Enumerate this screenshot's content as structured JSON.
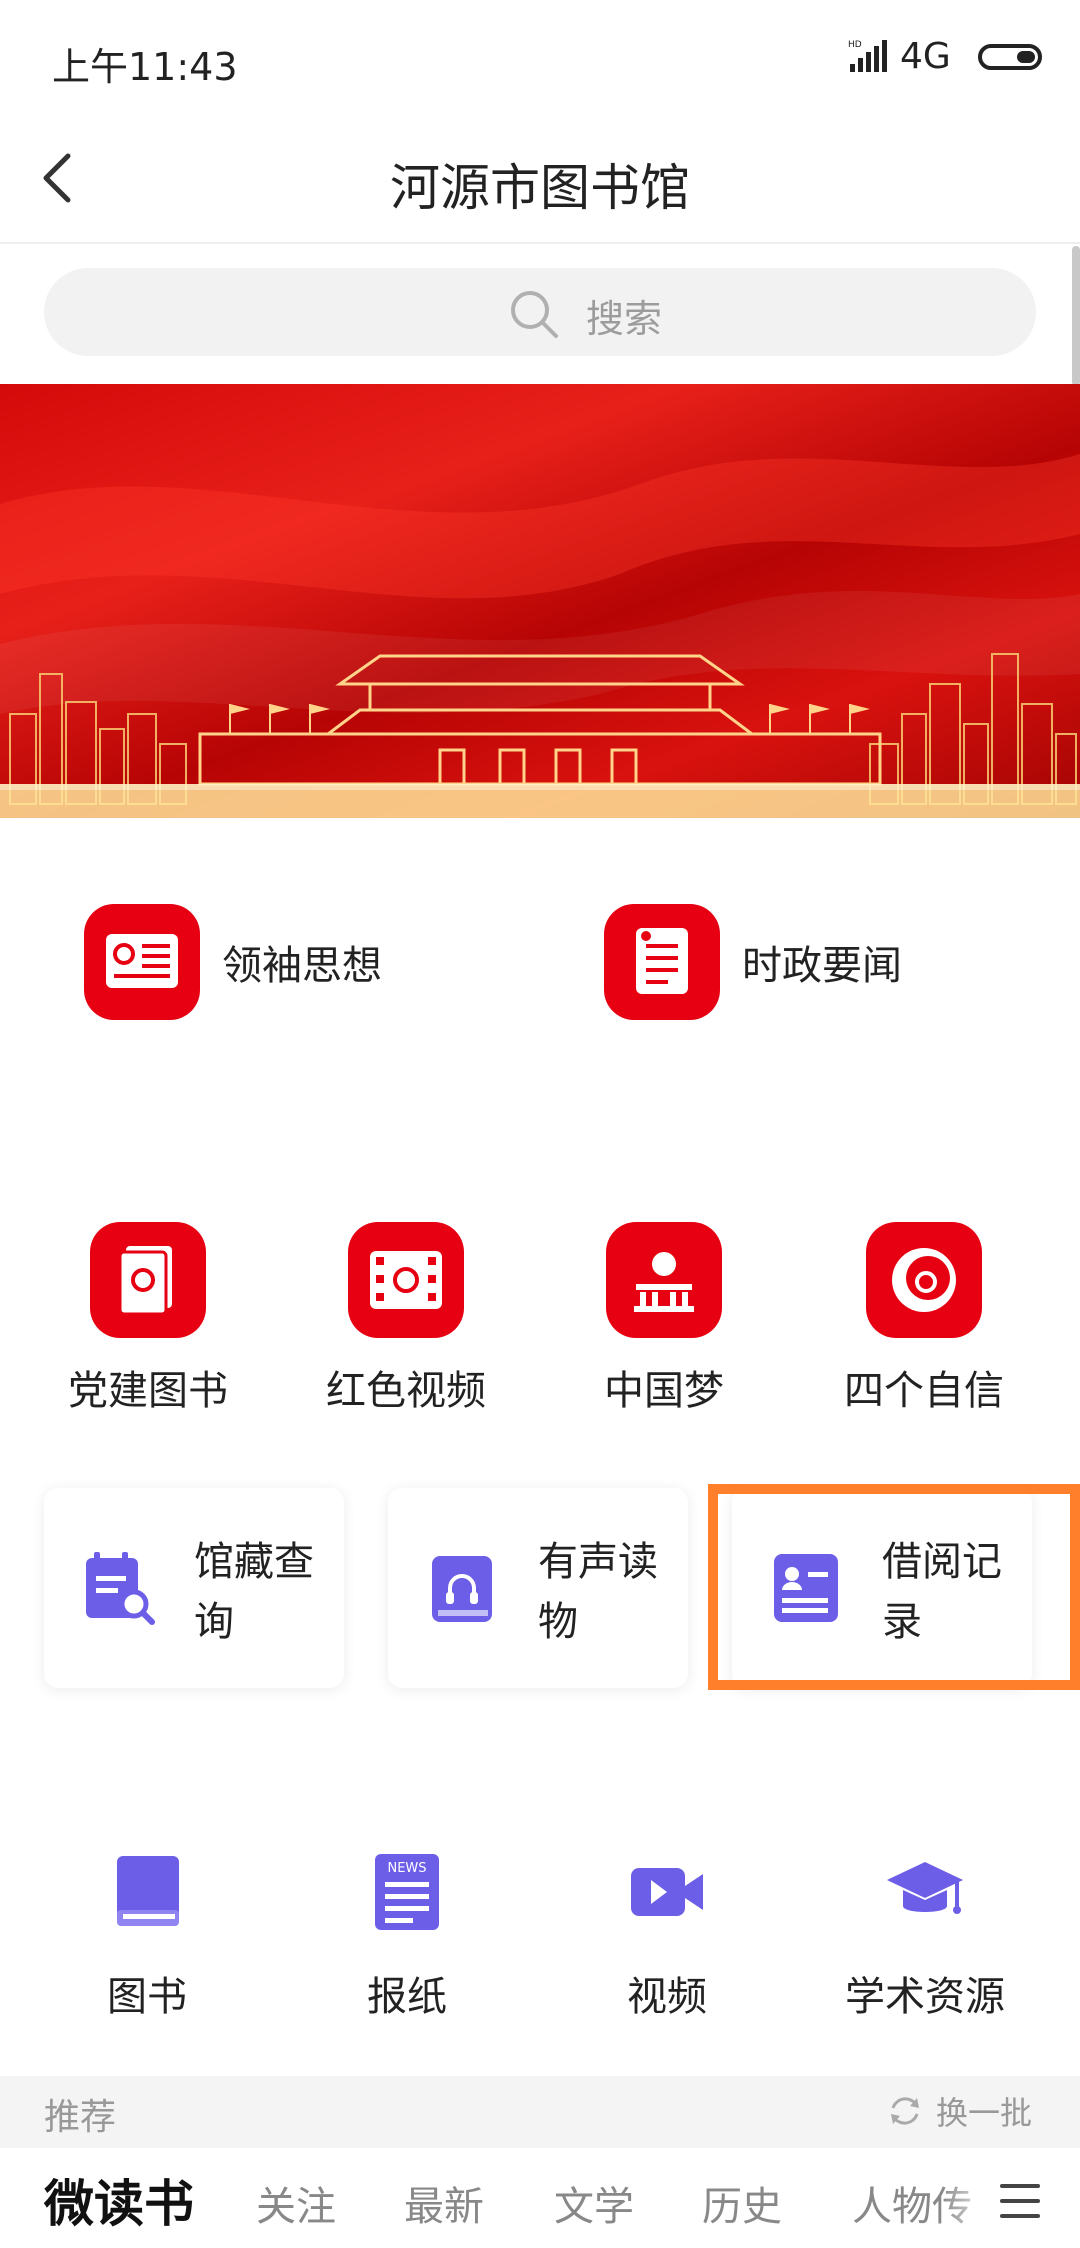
{
  "status_bar": {
    "time": "上午11:43",
    "network": "4G"
  },
  "header": {
    "title": "河源市图书馆"
  },
  "search": {
    "placeholder": "搜索"
  },
  "party_row1": [
    {
      "label": "领袖思想"
    },
    {
      "label": "时政要闻"
    }
  ],
  "party_row2": [
    {
      "label": "党建图书"
    },
    {
      "label": "红色视频"
    },
    {
      "label": "中国梦"
    },
    {
      "label": "四个自信"
    }
  ],
  "cards": [
    {
      "label": "馆藏查询"
    },
    {
      "label": "有声读物"
    },
    {
      "label": "借阅记录"
    }
  ],
  "resources": [
    {
      "label": "图书"
    },
    {
      "label": "报纸"
    },
    {
      "label": "视频"
    },
    {
      "label": "学术资源"
    }
  ],
  "recommend": {
    "label": "推荐",
    "refresh_label": "换一批"
  },
  "tabs": [
    "微读书",
    "关注",
    "最新",
    "文学",
    "历史",
    "人物传"
  ],
  "colors": {
    "party_red": "#e60012",
    "accent_purple": "#6d5ee8",
    "highlight_orange": "#ff7f2a"
  }
}
